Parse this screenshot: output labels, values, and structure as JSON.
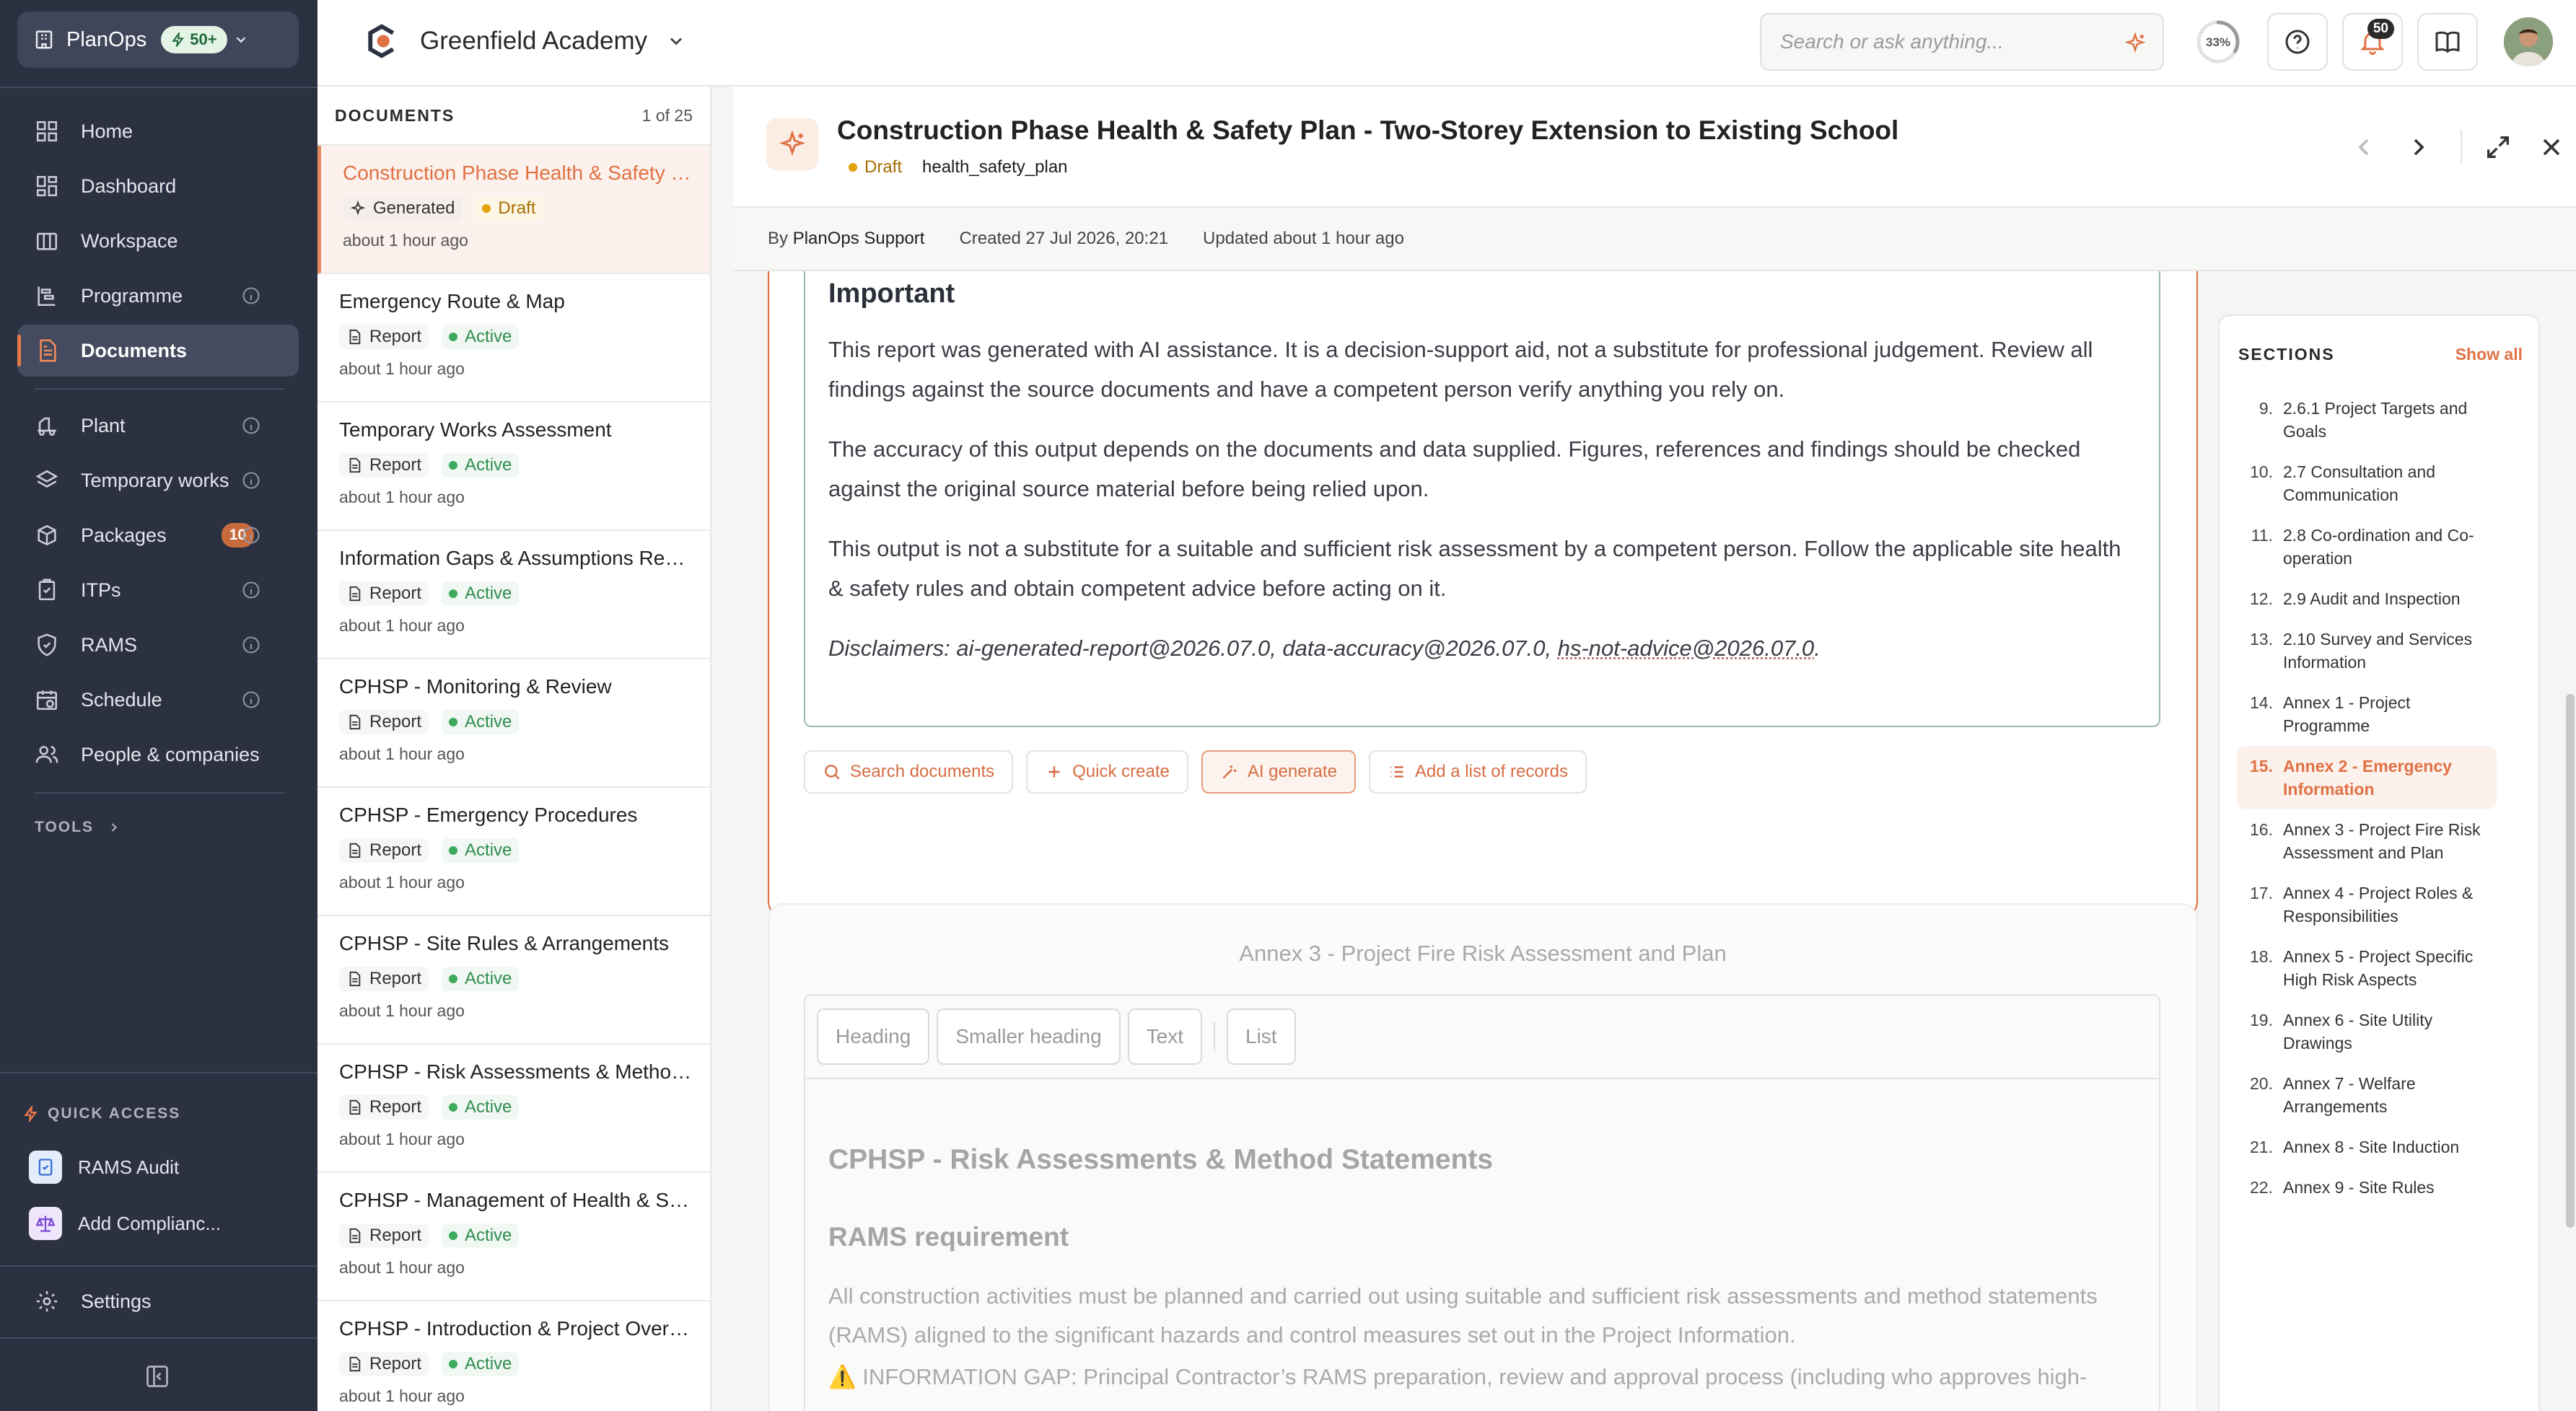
{
  "app": {
    "name": "PlanOps",
    "credits_badge": "50+",
    "colors": {
      "accent": "#e07144",
      "nav_bg": "#2c3142",
      "active_green": "#3daa5d",
      "draft_amber": "#e3a10a"
    }
  },
  "nav": {
    "items": [
      {
        "label": "Home",
        "icon": "grid-icon"
      },
      {
        "label": "Dashboard",
        "icon": "dashboard-icon"
      },
      {
        "label": "Workspace",
        "icon": "workspace-icon"
      },
      {
        "label": "Programme",
        "icon": "programme-icon"
      },
      {
        "label": "Documents",
        "icon": "document-icon"
      },
      {
        "label": "Plant",
        "icon": "plant-icon"
      },
      {
        "label": "Temporary works",
        "icon": "layers-icon"
      },
      {
        "label": "Packages",
        "icon": "package-icon",
        "count": "10"
      },
      {
        "label": "ITPs",
        "icon": "clipboard-icon"
      },
      {
        "label": "RAMS",
        "icon": "shield-icon"
      },
      {
        "label": "Schedule",
        "icon": "schedule-icon"
      },
      {
        "label": "People & companies",
        "icon": "people-icon"
      }
    ],
    "tools_label": "TOOLS",
    "quick_access_label": "QUICK ACCESS",
    "quick_access": [
      {
        "label": "RAMS Audit",
        "icon": "audit-icon"
      },
      {
        "label": "Add Complianc...",
        "icon": "scales-icon"
      }
    ],
    "settings_label": "Settings"
  },
  "topbar": {
    "org_name": "Greenfield Academy",
    "search_placeholder": "Search or ask anything...",
    "progress_label": "33%",
    "progress_value": 0.33,
    "notification_count": "50"
  },
  "doclist": {
    "title": "DOCUMENTS",
    "count": "1 of 25",
    "items": [
      {
        "title": "Construction Phase Health & Safety Plan - Two-Storey Extension to Existing School",
        "type": "Generated",
        "status": "Draft",
        "meta": "about 1 hour ago",
        "selected": true
      },
      {
        "title": "Emergency Route & Map",
        "type": "Report",
        "status": "Active",
        "meta": "about 1 hour ago"
      },
      {
        "title": "Temporary Works Assessment",
        "type": "Report",
        "status": "Active",
        "meta": "about 1 hour ago"
      },
      {
        "title": "Information Gaps & Assumptions Register",
        "type": "Report",
        "status": "Active",
        "meta": "about 1 hour ago"
      },
      {
        "title": "CPHSP - Monitoring & Review",
        "type": "Report",
        "status": "Active",
        "meta": "about 1 hour ago"
      },
      {
        "title": "CPHSP - Emergency Procedures",
        "type": "Report",
        "status": "Active",
        "meta": "about 1 hour ago"
      },
      {
        "title": "CPHSP - Site Rules & Arrangements",
        "type": "Report",
        "status": "Active",
        "meta": "about 1 hour ago"
      },
      {
        "title": "CPHSP - Risk Assessments & Method Statements",
        "type": "Report",
        "status": "Active",
        "meta": "about 1 hour ago"
      },
      {
        "title": "CPHSP - Management of Health & Safety",
        "type": "Report",
        "status": "Active",
        "meta": "about 1 hour ago"
      },
      {
        "title": "CPHSP - Introduction & Project Overview",
        "type": "Report",
        "status": "Active",
        "meta": "about 1 hour ago"
      }
    ]
  },
  "document": {
    "title": "Construction Phase Health & Safety Plan - Two-Storey Extension to Existing School",
    "status": "Draft",
    "doc_type": "health_safety_plan",
    "by_label": "By",
    "author": "PlanOps Support",
    "created": "Created 27 Jul 2026, 20:21",
    "updated": "Updated about 1 hour ago",
    "important": {
      "heading": "Important",
      "p1": "This report was generated with AI assistance. It is a decision-support aid, not a substitute for professional judgement. Review all findings against the source documents and have a competent person verify anything you rely on.",
      "p2": "The accuracy of this output depends on the documents and data supplied. Figures, references and findings should be checked against the original source material before being relied upon.",
      "p3": "This output is not a substitute for a suitable and sufficient risk assessment by a competent person. Follow the applicable site health & safety rules and obtain competent advice before acting on it.",
      "disclaimers_prefix": "Disclaimers: ai-generated-report@2026.07.0, data-accuracy@2026.07.0, ",
      "disclaimers_last": "hs-not-advice@2026.07.0",
      "disclaimers_suffix": "."
    },
    "actions": {
      "search": "Search documents",
      "quick_create": "Quick create",
      "ai_generate": "AI generate",
      "add_list": "Add a list of records"
    },
    "annex": {
      "title": "Annex 3 - Project Fire Risk Assessment and Plan",
      "toolbar": [
        "Heading",
        "Smaller heading",
        "Text",
        "List"
      ],
      "h2": "CPHSP - Risk Assessments & Method Statements",
      "h4": "RAMS requirement",
      "p1": "All construction activities must be planned and carried out using suitable and sufficient risk assessments and method statements (RAMS) aligned to the significant hazards and control measures set out in the Project Information.",
      "p2": "⚠️ INFORMATION GAP: Principal Contractor’s RAMS preparation, review and approval process (including who approves high-"
    }
  },
  "sections": {
    "title": "SECTIONS",
    "show_all": "Show all",
    "items": [
      {
        "n": "9.",
        "label": "2.6.1 Project Targets and Goals"
      },
      {
        "n": "10.",
        "label": "2.7 Consultation and Communication"
      },
      {
        "n": "11.",
        "label": "2.8 Co-ordination and Co-operation"
      },
      {
        "n": "12.",
        "label": "2.9 Audit and Inspection"
      },
      {
        "n": "13.",
        "label": "2.10 Survey and Services Information"
      },
      {
        "n": "14.",
        "label": "Annex 1 - Project Programme"
      },
      {
        "n": "15.",
        "label": "Annex 2 - Emergency Information",
        "current": true
      },
      {
        "n": "16.",
        "label": "Annex 3 - Project Fire Risk Assessment and Plan"
      },
      {
        "n": "17.",
        "label": "Annex 4 - Project Roles & Responsibilities"
      },
      {
        "n": "18.",
        "label": "Annex 5 - Project Specific High Risk Aspects"
      },
      {
        "n": "19.",
        "label": "Annex 6 - Site Utility Drawings"
      },
      {
        "n": "20.",
        "label": "Annex 7 - Welfare Arrangements"
      },
      {
        "n": "21.",
        "label": "Annex 8 - Site Induction"
      },
      {
        "n": "22.",
        "label": "Annex 9 - Site Rules"
      }
    ]
  }
}
